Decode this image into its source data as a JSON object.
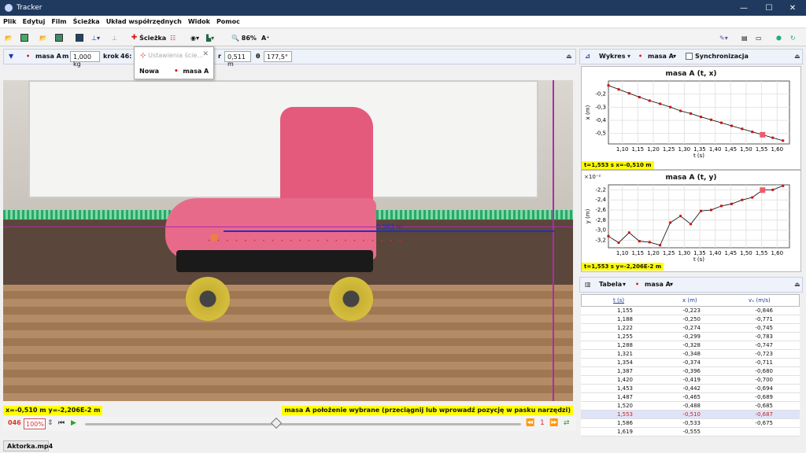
{
  "window": {
    "title": "Tracker",
    "filename": "Aktorka.mp4"
  },
  "menu": [
    "Plik",
    "Edytuj",
    "Film",
    "Ścieżka",
    "Układ współrzędnych",
    "Widok",
    "Pomoc"
  ],
  "toolbar": {
    "track_label": "Ścieżka",
    "zoom": "86%"
  },
  "trackbar": {
    "mass_track": "masa A",
    "m_label": "m",
    "m_value": "1,000 kg",
    "step_label": "krok",
    "step_value": "46:",
    "r_label": "r",
    "r_value": "0,511 m",
    "theta_label": "θ",
    "theta_value": "177,5°"
  },
  "popup": {
    "title": "Ustawienia ście...",
    "new_label": "Nowa",
    "track": "masa A"
  },
  "video": {
    "axis_length_label": "0,563 m"
  },
  "status": {
    "coords": "x=-0,510 m  y=-2,206E-2 m",
    "message": "masa A położenie wybrane (przeciągnij lub wprowadź pozycję w pasku narzędzi)"
  },
  "player": {
    "frame": "046",
    "zoom": "100%",
    "speed_label": "1"
  },
  "chart_toolbar": {
    "view": "Wykres",
    "track": "masa A",
    "sync_label": "Synchronizacja"
  },
  "chart_data": [
    {
      "type": "scatter",
      "title": "masa A (t, x)",
      "xlabel": "t (s)",
      "ylabel": "x (m)",
      "x_ticks": [
        "1,10",
        "1,15",
        "1,20",
        "1,25",
        "1,30",
        "1,35",
        "1,40",
        "1,45",
        "1,50",
        "1,55",
        "1,60"
      ],
      "y_ticks": [
        "-0,2",
        "-0,3",
        "-0,4",
        "-0,5"
      ],
      "xlim": [
        1.055,
        1.64
      ],
      "ylim": [
        -0.58,
        -0.1
      ],
      "x": [
        1.055,
        1.088,
        1.122,
        1.155,
        1.188,
        1.222,
        1.255,
        1.288,
        1.321,
        1.354,
        1.387,
        1.42,
        1.453,
        1.487,
        1.52,
        1.553,
        1.586,
        1.619
      ],
      "y": [
        -0.134,
        -0.164,
        -0.194,
        -0.223,
        -0.25,
        -0.274,
        -0.299,
        -0.328,
        -0.348,
        -0.374,
        -0.396,
        -0.419,
        -0.442,
        -0.465,
        -0.488,
        -0.51,
        -0.533,
        -0.555
      ],
      "selected_index": 15,
      "readout": "t=1,553 s  x=-0,510 m"
    },
    {
      "type": "scatter",
      "title": "masa A (t, y)",
      "xlabel": "t (s)",
      "ylabel": "y (m)",
      "y_multiplier": "×10⁻²",
      "x_ticks": [
        "1,10",
        "1,15",
        "1,20",
        "1,25",
        "1,30",
        "1,35",
        "1,40",
        "1,45",
        "1,50",
        "1,55",
        "1,60"
      ],
      "y_ticks": [
        "-2,2",
        "-2,4",
        "-2,6",
        "-2,8",
        "-3,0",
        "-3,2"
      ],
      "xlim": [
        1.055,
        1.64
      ],
      "ylim": [
        -3.35,
        -2.1
      ],
      "x": [
        1.055,
        1.088,
        1.122,
        1.155,
        1.188,
        1.222,
        1.255,
        1.288,
        1.321,
        1.354,
        1.387,
        1.42,
        1.453,
        1.487,
        1.52,
        1.553,
        1.586,
        1.619
      ],
      "y": [
        -3.12,
        -3.25,
        -3.05,
        -3.22,
        -3.24,
        -3.3,
        -2.85,
        -2.72,
        -2.88,
        -2.62,
        -2.6,
        -2.52,
        -2.48,
        -2.4,
        -2.35,
        -2.206,
        -2.2,
        -2.12
      ],
      "selected_index": 15,
      "readout": "t=1,553 s  y=-2,206E-2 m"
    }
  ],
  "table_toolbar": {
    "view": "Tabela",
    "track": "masa A"
  },
  "table": {
    "headers": [
      "t (s)",
      "x (m)",
      "vₓ (m/s)"
    ],
    "rows": [
      [
        "1,155",
        "-0,223",
        "-0,846"
      ],
      [
        "1,188",
        "-0,250",
        "-0,771"
      ],
      [
        "1,222",
        "-0,274",
        "-0,745"
      ],
      [
        "1,255",
        "-0,299",
        "-0,783"
      ],
      [
        "1,288",
        "-0,328",
        "-0,747"
      ],
      [
        "1,321",
        "-0,348",
        "-0,723"
      ],
      [
        "1,354",
        "-0,374",
        "-0,711"
      ],
      [
        "1,387",
        "-0,396",
        "-0,680"
      ],
      [
        "1,420",
        "-0,419",
        "-0,700"
      ],
      [
        "1,453",
        "-0,442",
        "-0,694"
      ],
      [
        "1,487",
        "-0,465",
        "-0,689"
      ],
      [
        "1,520",
        "-0,488",
        "-0,685"
      ],
      [
        "1,553",
        "-0,510",
        "-0,687"
      ],
      [
        "1,586",
        "-0,533",
        "-0,675"
      ],
      [
        "1,619",
        "-0,555",
        ""
      ]
    ],
    "selected_row": 12
  },
  "colors": {
    "accent": "#2030c8",
    "highlight": "#ffff00",
    "axis_magenta": "#b02aa8",
    "track_red": "#d11111"
  }
}
